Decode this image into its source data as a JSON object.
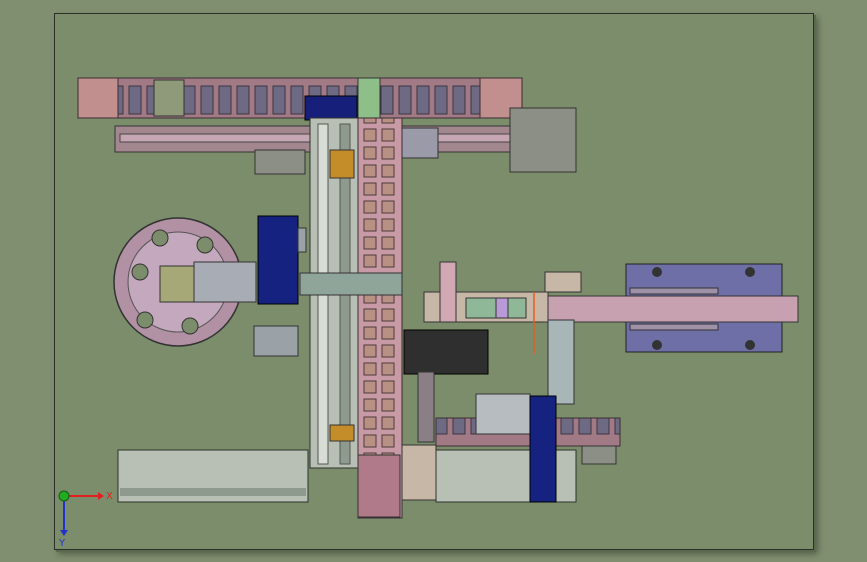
{
  "view": {
    "background": "#7f8f6f",
    "sheet_color": "#7c8d6b"
  },
  "triad": {
    "x_label": "X",
    "y_label": "Y",
    "x_color": "#e02020",
    "y_color": "#2233cc",
    "z_color": "#22aa22"
  },
  "icons": [
    "coordinate-triad-icon"
  ]
}
